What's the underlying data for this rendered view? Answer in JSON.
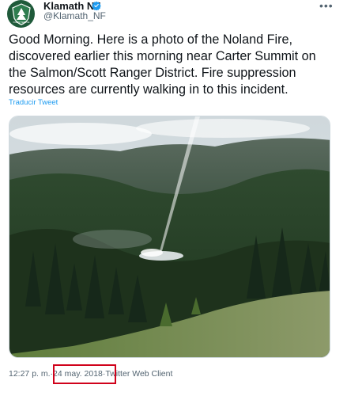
{
  "author": {
    "name": "Klamath NF",
    "handle": "@Klamath_NF",
    "avatar_icon": "forest-service-shield-icon",
    "avatar_text": "FOREST SERVICE",
    "verified_icon": "verified-badge-icon"
  },
  "tweet": {
    "text": "Good Morning. Here is a photo of the Noland Fire,\ndiscovered earlier this morning near Carter Summit on\nthe Salmon/Scott Ranger District. Fire suppression\nresources are currently walking in to this incident.",
    "translate_label": "Traducir Tweet"
  },
  "media": {
    "description_icon": "forest-fire-photo"
  },
  "meta": {
    "time": "12:27 p. m.",
    "sep1": " · ",
    "date": "24 may. 2018",
    "sep2": " · ",
    "client": "Twitter Web Client"
  },
  "colors": {
    "link": "#1d9bf0",
    "highlight": "#d0021b",
    "secondary_text": "#536471"
  }
}
